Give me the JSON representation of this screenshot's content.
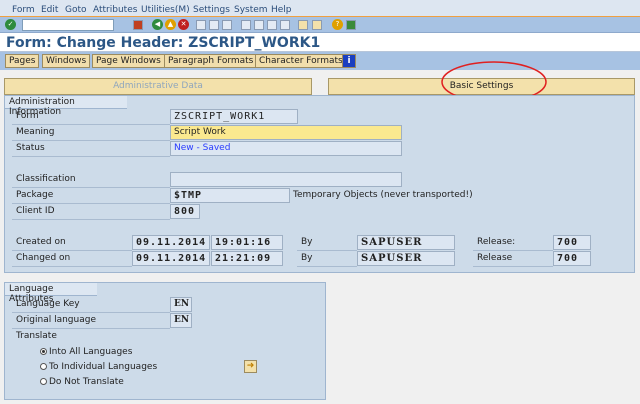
{
  "menu": [
    "Form",
    "Edit",
    "Goto",
    "Attributes",
    "Utilities(M)",
    "Settings",
    "System",
    "Help"
  ],
  "title": "Form: Change Header: ZSCRIPT_WORK1",
  "app_toolbar": [
    "Pages",
    "Windows",
    "Page Windows",
    "Paragraph Formats",
    "Character Formats"
  ],
  "tabs": {
    "admin": "Administrative Data",
    "basic": "Basic Settings"
  },
  "admin": {
    "header": "Administration Information",
    "form_label": "Form",
    "form_value": "ZSCRIPT_WORK1",
    "meaning_label": "Meaning",
    "meaning_value": "Script Work",
    "status_label": "Status",
    "status_value": "New - Saved",
    "classification_label": "Classification",
    "classification_value": "",
    "package_label": "Package",
    "package_value": "$TMP",
    "package_desc": "Temporary Objects (never transported!)",
    "client_label": "Client ID",
    "client_value": "800",
    "created_label": "Created on",
    "created_date": "09.11.2014",
    "created_time": "19:01:16",
    "created_by_label": "By",
    "created_by": "SAPUSER",
    "created_release_label": "Release:",
    "created_release": "700",
    "changed_label": "Changed on",
    "changed_date": "09.11.2014",
    "changed_time": "21:21:09",
    "changed_by_label": "By",
    "changed_by": "SAPUSER",
    "changed_release_label": "Release",
    "changed_release": "700"
  },
  "lang": {
    "header": "Language Attributes",
    "key_label": "Language Key",
    "key_value": "EN",
    "orig_label": "Original language",
    "orig_value": "EN",
    "translate_label": "Translate",
    "options": [
      "Into All Languages",
      "To Individual Languages",
      "Do Not Translate"
    ],
    "selected": 0
  },
  "colors": {
    "accent": "#2c5786",
    "annotation": "#e02020",
    "status": "#2a3cff"
  }
}
